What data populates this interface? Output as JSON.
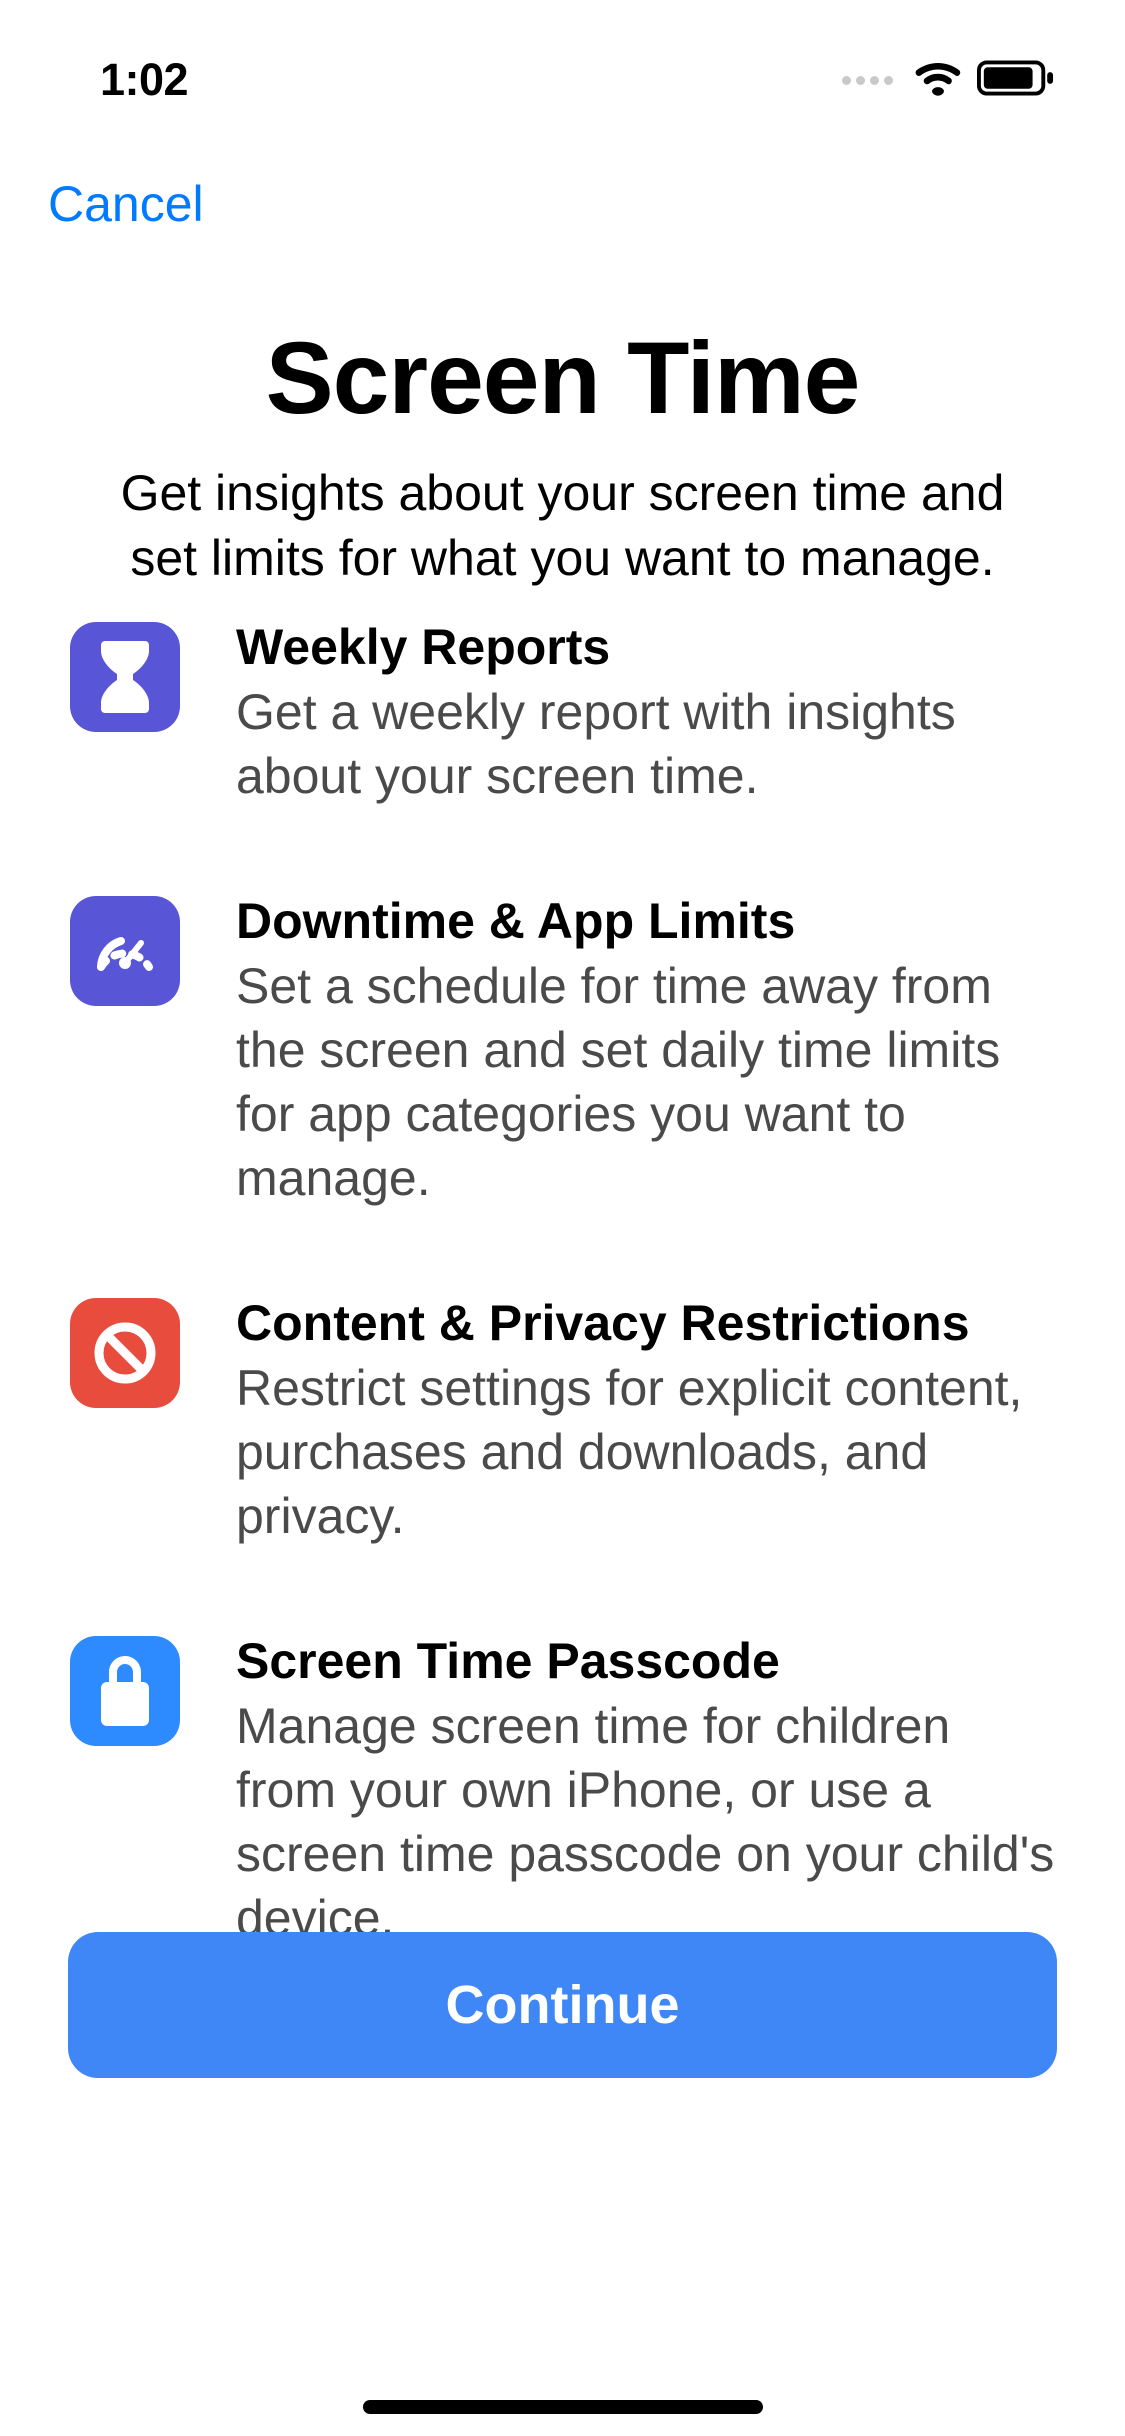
{
  "status": {
    "time": "1:02"
  },
  "nav": {
    "cancel": "Cancel"
  },
  "header": {
    "title": "Screen Time",
    "subtitle": "Get insights about your screen time and set limits for what you want to manage."
  },
  "features": [
    {
      "icon": "hourglass-icon",
      "icon_color": "#5856d6",
      "title": "Weekly Reports",
      "desc": "Get a weekly report with insights about your screen time."
    },
    {
      "icon": "gauge-icon",
      "icon_color": "#5856d6",
      "title": "Downtime & App Limits",
      "desc": "Set a schedule for time away from the screen and set daily time limits for app categories you want to manage."
    },
    {
      "icon": "no-symbol-icon",
      "icon_color": "#e74c3c",
      "title": "Content & Privacy Restrictions",
      "desc": "Restrict settings for explicit content, purchases and downloads, and privacy."
    },
    {
      "icon": "lock-icon",
      "icon_color": "#2e8bff",
      "title": "Screen Time Passcode",
      "desc": "Manage screen time for children from your own iPhone, or use a screen time passcode on your child's device."
    }
  ],
  "primary_action": "Continue"
}
